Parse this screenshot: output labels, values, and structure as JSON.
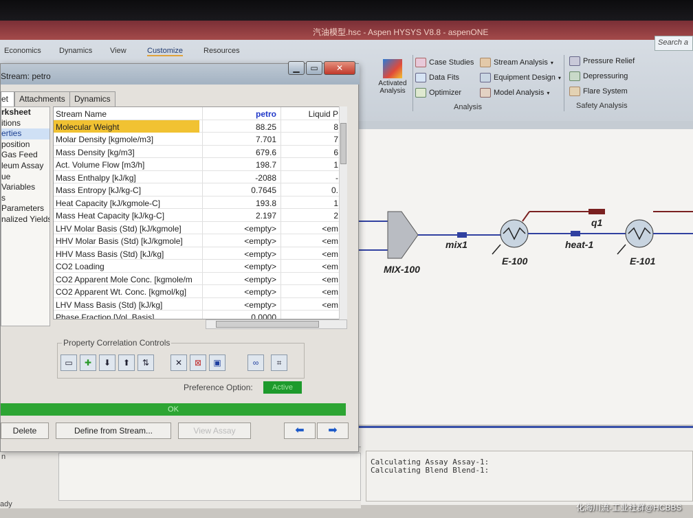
{
  "app": {
    "title": "汽油模型.hsc - Aspen HYSYS V8.8 - aspenONE",
    "search_placeholder": "Search a"
  },
  "ribbon": {
    "tabs": [
      "Economics",
      "Dynamics",
      "View",
      "Customize",
      "Resources"
    ],
    "active_tab": "Customize",
    "activated_analysis": "Activated\nAnalysis",
    "analysis": {
      "items": [
        "Case Studies",
        "Data Fits",
        "Optimizer",
        "Stream Analysis",
        "Equipment Design",
        "Model Analysis"
      ],
      "label": "Analysis"
    },
    "safety": {
      "items": [
        "Pressure Relief",
        "Depressuring",
        "Flare System"
      ],
      "label": "Safety Analysis"
    }
  },
  "dialog": {
    "title": "Stream: petro",
    "tabs": [
      "et",
      "Attachments",
      "Dynamics"
    ],
    "nav": [
      "rksheet",
      "itions",
      "erties",
      "position",
      "Gas Feed",
      "leum Assay",
      "ue",
      "Variables",
      "s",
      "Parameters",
      "nalized Yields"
    ],
    "nav_selected": 2,
    "grid": {
      "header": [
        "Stream Name",
        "petro",
        "Liquid P"
      ],
      "rows": [
        [
          "Molecular Weight",
          "88.25",
          "8"
        ],
        [
          "Molar Density [kgmole/m3]",
          "7.701",
          "7"
        ],
        [
          "Mass Density [kg/m3]",
          "679.6",
          "6"
        ],
        [
          "Act. Volume Flow [m3/h]",
          "198.7",
          "1"
        ],
        [
          "Mass Enthalpy [kJ/kg]",
          "-2088",
          "-"
        ],
        [
          "Mass Entropy [kJ/kg-C]",
          "0.7645",
          "0."
        ],
        [
          "Heat Capacity [kJ/kgmole-C]",
          "193.8",
          "1"
        ],
        [
          "Mass Heat Capacity [kJ/kg-C]",
          "2.197",
          "2"
        ],
        [
          "LHV Molar Basis (Std) [kJ/kgmole]",
          "<empty>",
          "<em"
        ],
        [
          "HHV Molar Basis (Std) [kJ/kgmole]",
          "<empty>",
          "<em"
        ],
        [
          "HHV Mass Basis (Std) [kJ/kg]",
          "<empty>",
          "<em"
        ],
        [
          "CO2 Loading",
          "<empty>",
          "<em"
        ],
        [
          "CO2 Apparent Mole Conc. [kgmole/m",
          "<empty>",
          "<em"
        ],
        [
          "CO2 Apparent Wt. Conc. [kgmol/kg]",
          "<empty>",
          "<em"
        ],
        [
          "LHV Mass Basis (Std) [kJ/kg]",
          "<empty>",
          "<em"
        ],
        [
          "Phase Fraction [Vol. Basis]",
          "0.0000",
          ""
        ]
      ]
    },
    "pcc_label": "Property Correlation Controls",
    "preference_label": "Preference Option:",
    "preference_value": "Active",
    "status_ok": "OK",
    "buttons": {
      "delete": "Delete",
      "define": "Define from Stream...",
      "view_assay": "View Assay"
    }
  },
  "flowsheet": {
    "labels": {
      "mixer": "MIX-100",
      "mix1": "mix1",
      "e100": "E-100",
      "heat1": "heat-1",
      "q1": "q1",
      "e101": "E-101"
    }
  },
  "console": {
    "lines": "Calculating Assay Assay-1:\nCalculating Blend Blend-1:"
  },
  "status": "ady",
  "left_tiny": "n",
  "watermark": "化海川流-工业社群@HCBBS"
}
